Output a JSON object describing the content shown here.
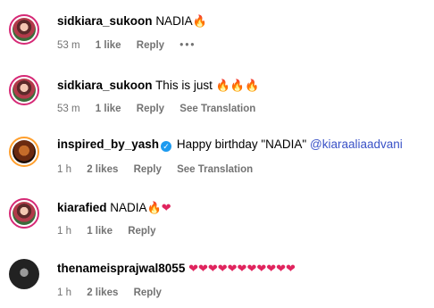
{
  "comments": [
    {
      "user": "sidkiara_sukoon",
      "text": "NADIA",
      "emojis": "🔥",
      "time": "53 m",
      "likes": "1 like",
      "reply": "Reply",
      "more": "•••"
    },
    {
      "user": "sidkiara_sukoon",
      "text": "This is just",
      "emojis": "🔥🔥🔥",
      "time": "53 m",
      "likes": "1 like",
      "reply": "Reply",
      "translate": "See Translation"
    },
    {
      "user": "inspired_by_yash",
      "text": "Happy birthday \"NADIA\"",
      "mention": "@kiaraaliaadvani",
      "time": "1 h",
      "likes": "2 likes",
      "reply": "Reply",
      "translate": "See Translation"
    },
    {
      "user": "kiarafied",
      "text": "NADIA",
      "emojis_fire": "🔥",
      "emojis_heart": "❤",
      "time": "1 h",
      "likes": "1 like",
      "reply": "Reply"
    },
    {
      "user": "thenameisprajwal8055",
      "emojis": "❤❤❤❤❤❤❤❤❤❤❤",
      "time": "1 h",
      "likes": "2 likes",
      "reply": "Reply"
    }
  ]
}
